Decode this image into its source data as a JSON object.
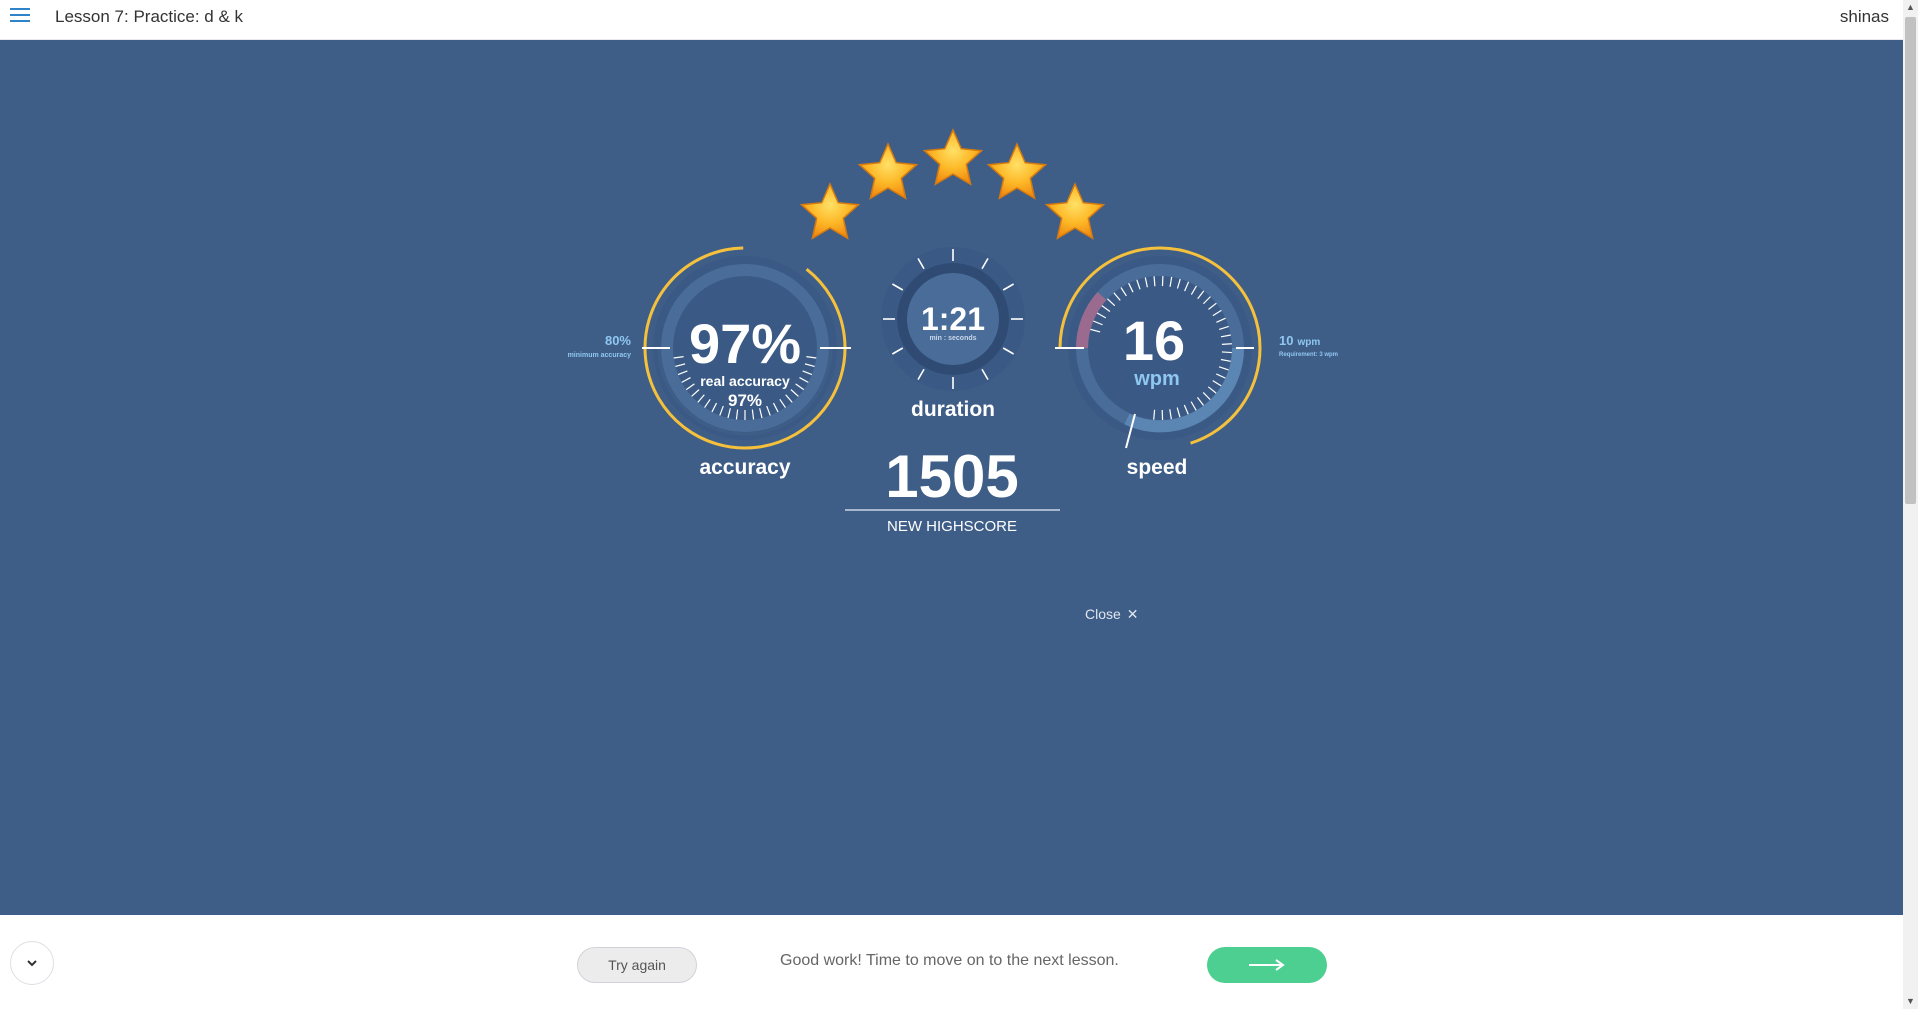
{
  "header": {
    "lesson_title": "Lesson 7: Practice: d & k",
    "username": "shinas"
  },
  "rating": {
    "stars": 5,
    "max_stars": 5,
    "star_color": "#f6a31a"
  },
  "accuracy": {
    "value": "97%",
    "real_accuracy_label": "real accuracy",
    "real_accuracy_value": "97%",
    "label": "accuracy",
    "minimum_value": "80%",
    "minimum_label": "minimum accuracy"
  },
  "duration": {
    "value": "1:21",
    "unit": "min : seconds",
    "label": "duration"
  },
  "speed": {
    "value": "16",
    "unit": "wpm",
    "label": "speed",
    "requirement_value": "10",
    "requirement_unit": "wpm",
    "requirement_label": "Requirement: 3 wpm"
  },
  "score": {
    "value": "1505",
    "label": "NEW HIGHSCORE"
  },
  "close_label": "Close",
  "footer": {
    "try_again_label": "Try again",
    "message": "Good work! Time to move on to the next lesson."
  },
  "colors": {
    "background": "#3f5e87",
    "gauge_ring": "#f5c13d",
    "accent_blue": "#8fc7f0",
    "next_button": "#4ccf90"
  }
}
